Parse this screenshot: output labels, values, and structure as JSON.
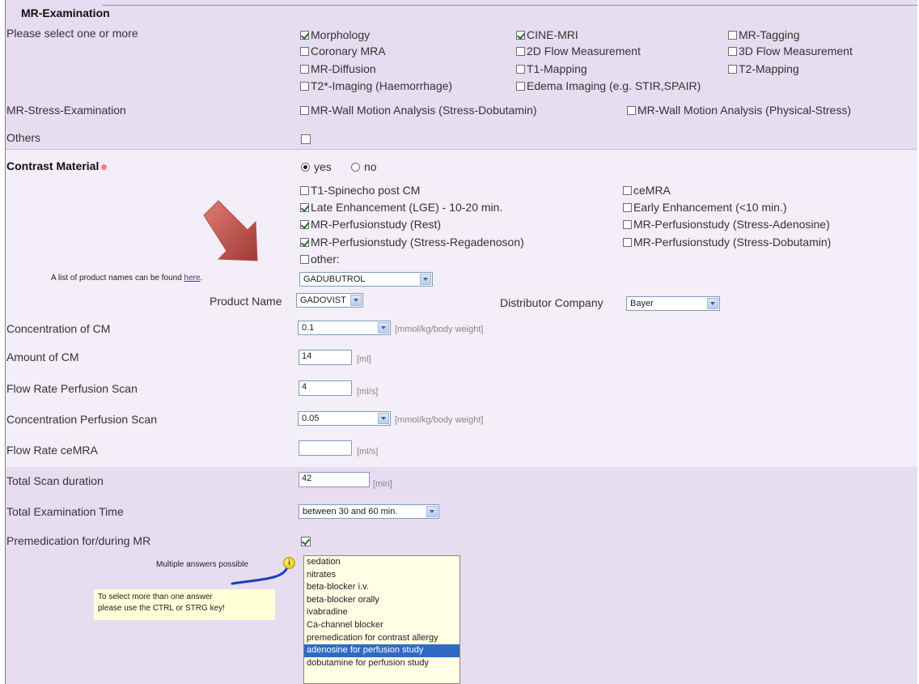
{
  "section": {
    "title": "MR-Examination"
  },
  "examination": {
    "label": "Please select one or more",
    "options": [
      {
        "label": "Morphology",
        "checked": true
      },
      {
        "label": "CINE-MRI",
        "checked": true
      },
      {
        "label": "MR-Tagging",
        "checked": false
      },
      {
        "label": "Coronary MRA",
        "checked": false
      },
      {
        "label": "2D Flow Measurement",
        "checked": false
      },
      {
        "label": "3D Flow Measurement",
        "checked": false
      },
      {
        "label": "MR-Diffusion",
        "checked": false
      },
      {
        "label": "T1-Mapping",
        "checked": false
      },
      {
        "label": "T2-Mapping",
        "checked": false
      },
      {
        "label": "T2*-Imaging (Haemorrhage)",
        "checked": false
      },
      {
        "label": "Edema Imaging (e.g. STIR,SPAIR)",
        "checked": false
      }
    ]
  },
  "stress": {
    "label": "MR-Stress-Examination",
    "options": [
      {
        "label": "MR-Wall Motion Analysis (Stress-Dobutamin)",
        "checked": false
      },
      {
        "label": "MR-Wall Motion Analysis (Physical-Stress)",
        "checked": false
      }
    ]
  },
  "others": {
    "label": "Others",
    "checked": false
  },
  "contrast": {
    "label": "Contrast Material",
    "required_color": "#f28080",
    "yes_label": "yes",
    "no_label": "no",
    "selected": "yes",
    "options": [
      {
        "label": "T1-Spinecho post CM",
        "checked": false
      },
      {
        "label": "ceMRA",
        "checked": false
      },
      {
        "label": "Late Enhancement (LGE) - 10-20 min.",
        "checked": true
      },
      {
        "label": "Early Enhancement (<10 min.)",
        "checked": false
      },
      {
        "label": "MR-Perfusionstudy (Rest)",
        "checked": true
      },
      {
        "label": "MR-Perfusionstudy (Stress-Adenosine)",
        "checked": false
      },
      {
        "label": "MR-Perfusionstudy (Stress-Regadenoson)",
        "checked": true
      },
      {
        "label": "MR-Perfusionstudy (Stress-Dobutamin)",
        "checked": false
      },
      {
        "label": "other:",
        "checked": false
      }
    ]
  },
  "product": {
    "hint_prefix": "A list of product names can be found ",
    "hint_link": "here",
    "hint_suffix": ".",
    "substance_value": "GADUBUTROL",
    "name_label": "Product Name",
    "name_value": "GADOVIST",
    "distributor_label": "Distributor Company",
    "distributor_value": "Bayer"
  },
  "fields": {
    "concentration_cm": {
      "label": "Concentration of CM",
      "value": "0.1",
      "unit": "[mmol/kg/body weight]"
    },
    "amount_cm": {
      "label": "Amount of CM",
      "value": "14",
      "unit": "[ml]"
    },
    "flow_perfusion": {
      "label": "Flow Rate Perfusion Scan",
      "value": "4",
      "unit": "[ml/s]"
    },
    "conc_perfusion": {
      "label": "Concentration Perfusion Scan",
      "value": "0.05",
      "unit": "[mmol/kg/body weight]"
    },
    "flow_cemra": {
      "label": "Flow Rate ceMRA",
      "value": "",
      "unit": "[ml/s]"
    },
    "scan_duration": {
      "label": "Total Scan duration",
      "value": "42",
      "unit": "[min]"
    },
    "exam_time": {
      "label": "Total Examination Time",
      "value": "between 30 and 60 min."
    }
  },
  "premedication": {
    "label": "Premedication for/during MR",
    "checked": true,
    "multiple_hint": "Multiple answers possible",
    "tooltip_line1": "To select more than one answer",
    "tooltip_line2": "please use the CTRL or STRG key!",
    "items": [
      "sedation",
      "nitrates",
      "beta-blocker i.v.",
      "beta-blocker orally",
      "ivabradine",
      "Ca-channel blocker",
      "premedication for contrast allergy",
      "adenosine for perfusion study",
      "dobutamine for perfusion study"
    ],
    "selected_item": "adenosine for perfusion study"
  },
  "colors": {
    "band": "#e7ddf0",
    "band_light": "#f3eef7",
    "arrow": "#c0504d",
    "selected": "#316ac5",
    "annotation_line": "#1f3fbf"
  }
}
